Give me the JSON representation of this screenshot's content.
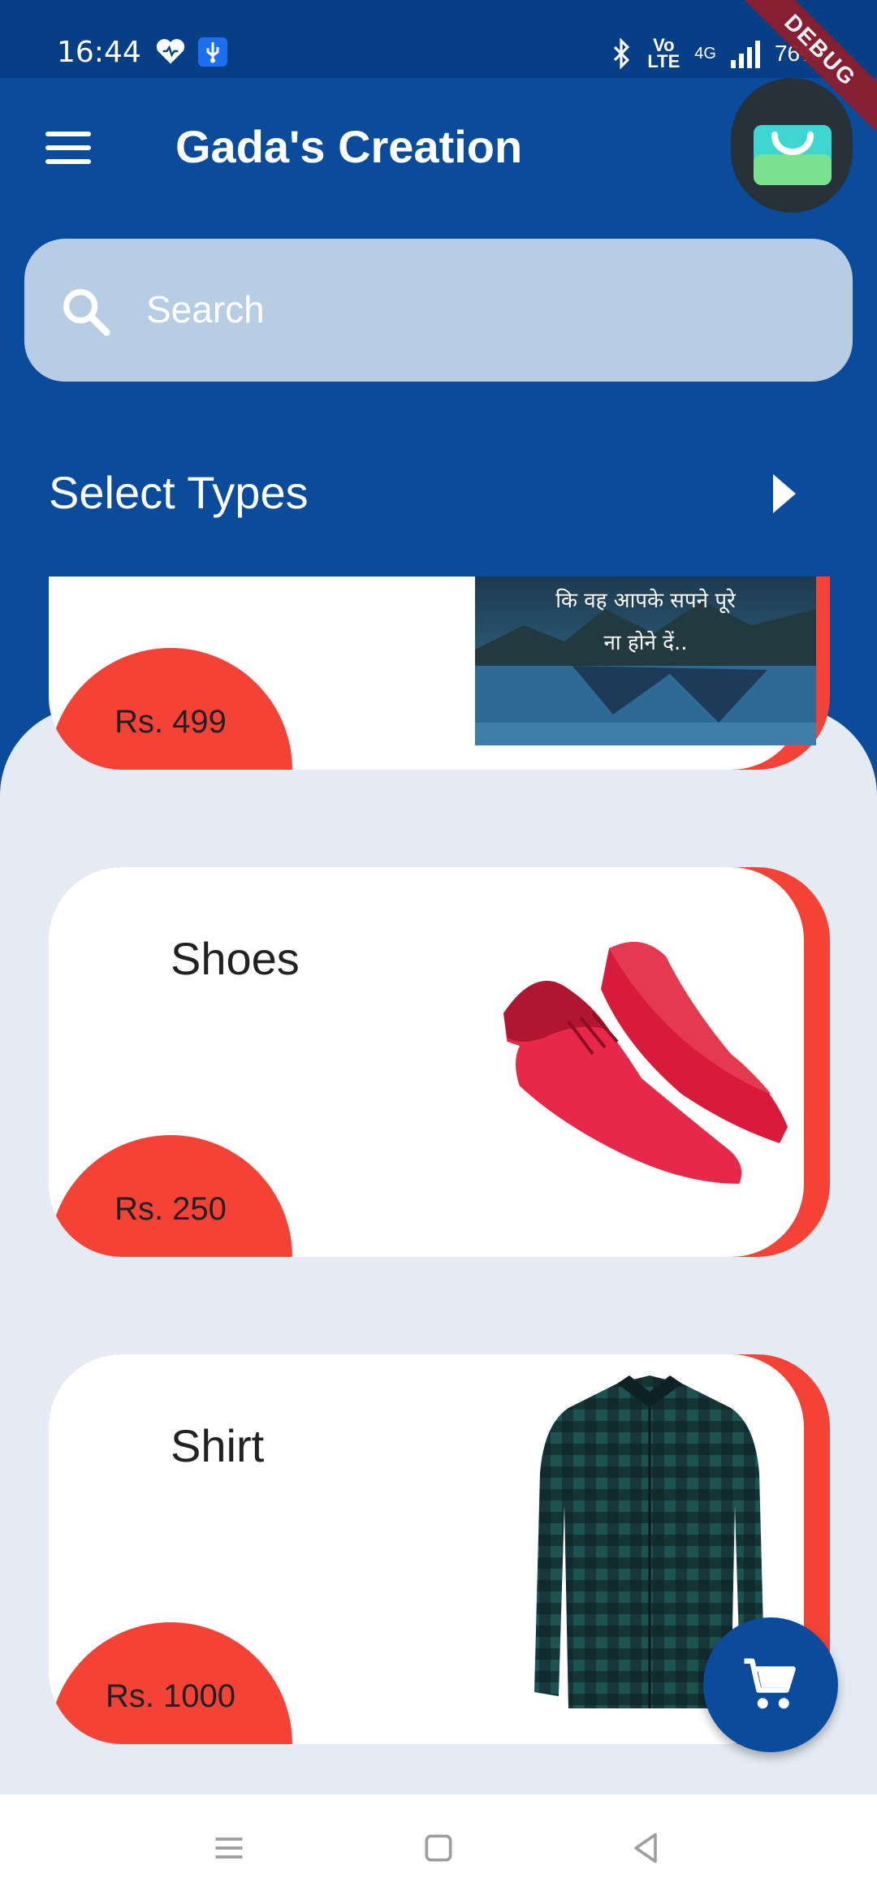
{
  "status_bar": {
    "time": "16:44",
    "battery": "76%",
    "network": "4G",
    "volte_top": "Vo",
    "volte_bottom": "LTE"
  },
  "debug_banner": "DEBUG",
  "app_bar": {
    "title": "Gada's Creation"
  },
  "search": {
    "placeholder": "Search"
  },
  "section": {
    "title": "Select Types"
  },
  "products": [
    {
      "name": "",
      "price": "Rs. 499",
      "poster_line1": "कि वह आपके सपने पूरे",
      "poster_line2": "ना होने दें.."
    },
    {
      "name": "Shoes",
      "price": "Rs. 250"
    },
    {
      "name": "Shirt",
      "price": "Rs. 1000"
    }
  ],
  "colors": {
    "primary": "#0a4b9c",
    "accent": "#f44336",
    "panel": "#e4ebf4",
    "search": "#b7cde3"
  },
  "icons": [
    "menu-icon",
    "shopping-bag-icon",
    "search-icon",
    "arrow-right-icon",
    "cart-icon",
    "recents-icon",
    "home-icon",
    "back-icon"
  ]
}
